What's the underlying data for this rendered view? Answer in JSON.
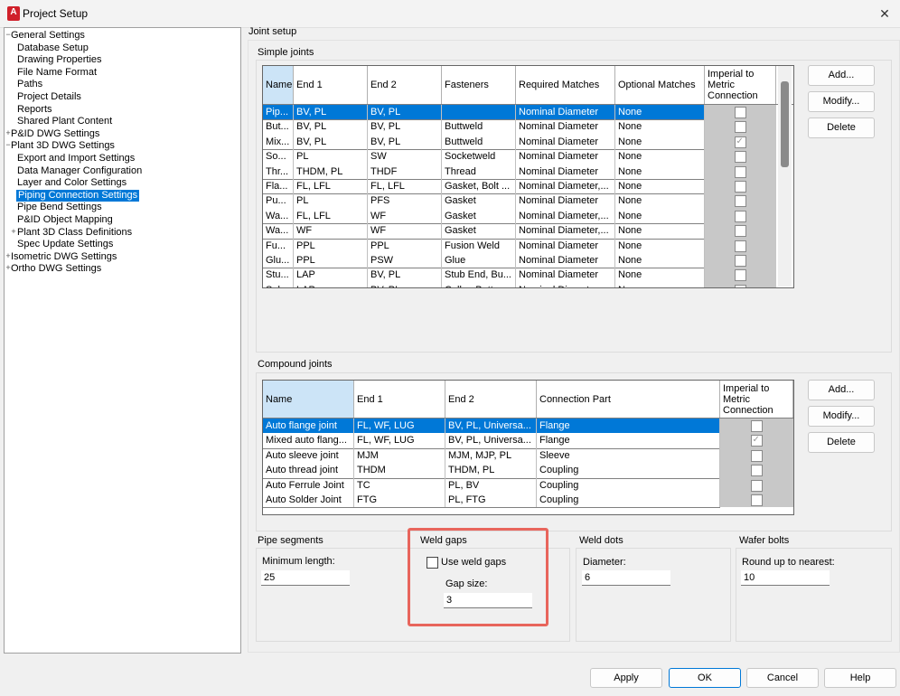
{
  "window": {
    "title": "Project Setup",
    "close_glyph": "✕",
    "app_icon_letter": "A"
  },
  "tree": [
    {
      "label": "General Settings",
      "level": 0,
      "exp": "−"
    },
    {
      "label": "Database Setup",
      "level": 1
    },
    {
      "label": "Drawing Properties",
      "level": 1
    },
    {
      "label": "File Name Format",
      "level": 1
    },
    {
      "label": "Paths",
      "level": 1
    },
    {
      "label": "Project Details",
      "level": 1
    },
    {
      "label": "Reports",
      "level": 1
    },
    {
      "label": "Shared Plant Content",
      "level": 1
    },
    {
      "label": "P&ID DWG Settings",
      "level": 0,
      "exp": "+"
    },
    {
      "label": "Plant 3D DWG Settings",
      "level": 0,
      "exp": "−"
    },
    {
      "label": "Export and Import Settings",
      "level": 1
    },
    {
      "label": "Data Manager Configuration",
      "level": 1
    },
    {
      "label": "Layer and Color Settings",
      "level": 1
    },
    {
      "label": "Piping Connection Settings",
      "level": 1,
      "selected": true
    },
    {
      "label": "Pipe Bend Settings",
      "level": 1
    },
    {
      "label": "P&ID Object Mapping",
      "level": 1
    },
    {
      "label": "Plant 3D Class Definitions",
      "level": 1,
      "exp": "+"
    },
    {
      "label": "Spec Update Settings",
      "level": 1
    },
    {
      "label": "Isometric DWG Settings",
      "level": 0,
      "exp": "+"
    },
    {
      "label": "Ortho DWG Settings",
      "level": 0,
      "exp": "+"
    }
  ],
  "joint_setup": {
    "label": "Joint setup"
  },
  "simple_joints": {
    "label": "Simple joints",
    "columns": [
      "Name",
      "End 1",
      "End 2",
      "Fasteners",
      "Required Matches",
      "Optional Matches",
      "Imperial to Metric Connection"
    ],
    "rows": [
      [
        "Pip...",
        "BV, PL",
        "BV, PL",
        "",
        "Nominal Diameter",
        "None",
        false
      ],
      [
        "But...",
        "BV, PL",
        "BV, PL",
        "Buttweld",
        "Nominal Diameter",
        "None",
        false
      ],
      [
        "Mix...",
        "BV, PL",
        "BV, PL",
        "Buttweld",
        "Nominal Diameter",
        "None",
        true
      ],
      [
        "So...",
        "PL",
        "SW",
        "Socketweld",
        "Nominal Diameter",
        "None",
        false
      ],
      [
        "Thr...",
        "THDM, PL",
        "THDF",
        "Thread",
        "Nominal Diameter",
        "None",
        false
      ],
      [
        "Fla...",
        "FL, LFL",
        "FL, LFL",
        "Gasket, Bolt ...",
        "Nominal Diameter,...",
        "None",
        false
      ],
      [
        "Pu...",
        "PL",
        "PFS",
        "Gasket",
        "Nominal Diameter",
        "None",
        false
      ],
      [
        "Wa...",
        "FL, LFL",
        "WF",
        "Gasket",
        "Nominal Diameter,...",
        "None",
        false
      ],
      [
        "Wa...",
        "WF",
        "WF",
        "Gasket",
        "Nominal Diameter,...",
        "None",
        false
      ],
      [
        "Fu...",
        "PPL",
        "PPL",
        "Fusion Weld",
        "Nominal Diameter",
        "None",
        false
      ],
      [
        "Glu...",
        "PPL",
        "PSW",
        "Glue",
        "Nominal Diameter",
        "None",
        false
      ],
      [
        "Stu...",
        "LAP",
        "BV, PL",
        "Stub End, Bu...",
        "Nominal Diameter",
        "None",
        false
      ],
      [
        "Sol...",
        "LAP",
        "BV, PL",
        "Collar, Butt...",
        "Nominal Diameter",
        "None",
        false
      ]
    ],
    "buttons": [
      "Add...",
      "Modify...",
      "Delete"
    ]
  },
  "compound_joints": {
    "label": "Compound joints",
    "columns": [
      "Name",
      "End 1",
      "End 2",
      "Connection Part",
      "Imperial to Metric Connection"
    ],
    "rows": [
      [
        "Auto flange joint",
        "FL, WF, LUG",
        "BV, PL, Universa...",
        "Flange",
        false
      ],
      [
        "Mixed auto flang...",
        "FL, WF, LUG",
        "BV, PL, Universa...",
        "Flange",
        true
      ],
      [
        "Auto sleeve joint",
        "MJM",
        "MJM, MJP, PL",
        "Sleeve",
        false
      ],
      [
        "Auto thread joint",
        "THDM",
        "THDM, PL",
        "Coupling",
        false
      ],
      [
        "Auto Ferrule Joint",
        "TC",
        "PL, BV",
        "Coupling",
        false
      ],
      [
        "Auto Solder Joint",
        "FTG",
        "PL, FTG",
        "Coupling",
        false
      ]
    ],
    "buttons": [
      "Add...",
      "Modify...",
      "Delete"
    ]
  },
  "pipe_segments": {
    "label": "Pipe segments",
    "field_label": "Minimum length:",
    "value": "25"
  },
  "weld_gaps": {
    "label": "Weld gaps",
    "checkbox_label": "Use weld gaps",
    "checked": false,
    "field_label": "Gap size:",
    "value": "3"
  },
  "weld_dots": {
    "label": "Weld dots",
    "field_label": "Diameter:",
    "value": "6"
  },
  "wafer_bolts": {
    "label": "Wafer bolts",
    "field_label": "Round up to nearest:",
    "value": "10"
  },
  "footer": {
    "apply": "Apply",
    "ok": "OK",
    "cancel": "Cancel",
    "help": "Help"
  },
  "colors": {
    "accent": "#0078d7",
    "header_selected": "#cce4f7",
    "highlight": "#e8655c"
  }
}
